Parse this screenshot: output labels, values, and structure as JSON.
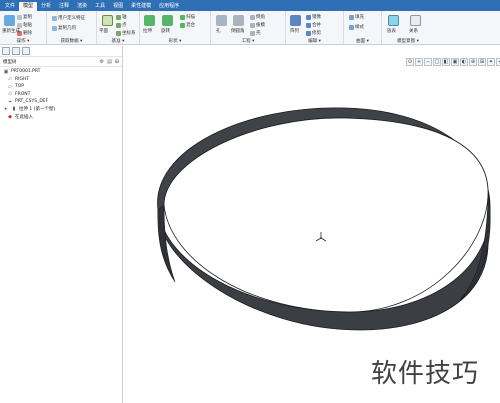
{
  "ribbon_tabs": [
    "文件",
    "模型",
    "分析",
    "注释",
    "渲染",
    "工具",
    "视图",
    "柔性建模",
    "应用程序"
  ],
  "active_tab": "模型",
  "ribbon_groups": [
    {
      "label": "操作 ▾",
      "items": [
        "重新生成",
        "复制",
        "粘贴",
        "删除"
      ]
    },
    {
      "label": "获取数据 ▾",
      "items": [
        "用户定义特征",
        "复制几何"
      ]
    },
    {
      "label": "基准 ▾",
      "items": [
        "平面",
        "轴",
        "点",
        "坐标系"
      ]
    },
    {
      "label": "形状 ▾",
      "items": [
        "拉伸",
        "旋转",
        "扫描",
        "混合"
      ]
    },
    {
      "label": "工程 ▾",
      "items": [
        "孔",
        "倒圆角",
        "倒角",
        "拔模",
        "壳"
      ]
    },
    {
      "label": "编辑 ▾",
      "items": [
        "阵列",
        "镜像",
        "合并",
        "修剪"
      ]
    },
    {
      "label": "曲面 ▾",
      "items": [
        "填充",
        "样式"
      ]
    },
    {
      "label": "模型意图 ▾",
      "items": [
        "族表",
        "关系"
      ]
    }
  ],
  "left_panel": {
    "title": "模型树",
    "tree": [
      {
        "icon": "part-icon",
        "label": "PRT0001.PRT"
      },
      {
        "icon": "plane-icon",
        "label": "RIGHT"
      },
      {
        "icon": "plane-icon",
        "label": "TOP"
      },
      {
        "icon": "plane-icon",
        "label": "FRONT"
      },
      {
        "icon": "csys-icon",
        "label": "PRT_CSYS_DEF"
      },
      {
        "icon": "extrude-icon",
        "label": "拉伸 1 (第一个壁)"
      },
      {
        "icon": "insert-icon",
        "label": "在此插入"
      }
    ]
  },
  "graphics_toolbar": [
    "⊙",
    "+",
    "−",
    "□",
    "◧",
    "▣",
    "◐",
    "⊕",
    "⊞",
    "✦",
    "⌖",
    "⊡"
  ],
  "watermark": "软件技巧",
  "colors": {
    "ribbon_tabs_bg": "#2f6fb5",
    "ring": "#3b3f44",
    "ring_edge": "#1b1d21"
  }
}
